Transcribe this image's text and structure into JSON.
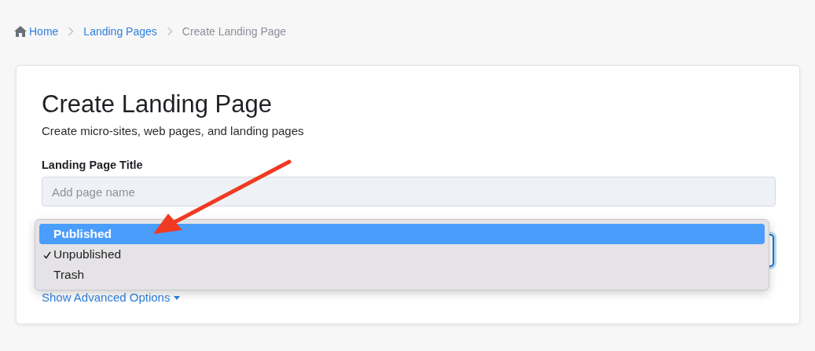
{
  "breadcrumb": [
    {
      "kind": "home",
      "label": "Home"
    },
    {
      "kind": "link",
      "label": "Landing Pages"
    },
    {
      "kind": "current",
      "label": "Create Landing Page"
    }
  ],
  "card": {
    "title": "Create Landing Page",
    "subtitle": "Create micro-sites, web pages, and landing pages",
    "title_field": {
      "label": "Landing Page Title",
      "placeholder": "Add page name"
    },
    "status_dropdown": {
      "options": [
        {
          "label": "Published",
          "selected": true,
          "checked": false
        },
        {
          "label": "Unpublished",
          "selected": false,
          "checked": true
        },
        {
          "label": "Trash",
          "selected": false,
          "checked": false
        }
      ]
    },
    "advanced_link": "Show Advanced Options"
  }
}
